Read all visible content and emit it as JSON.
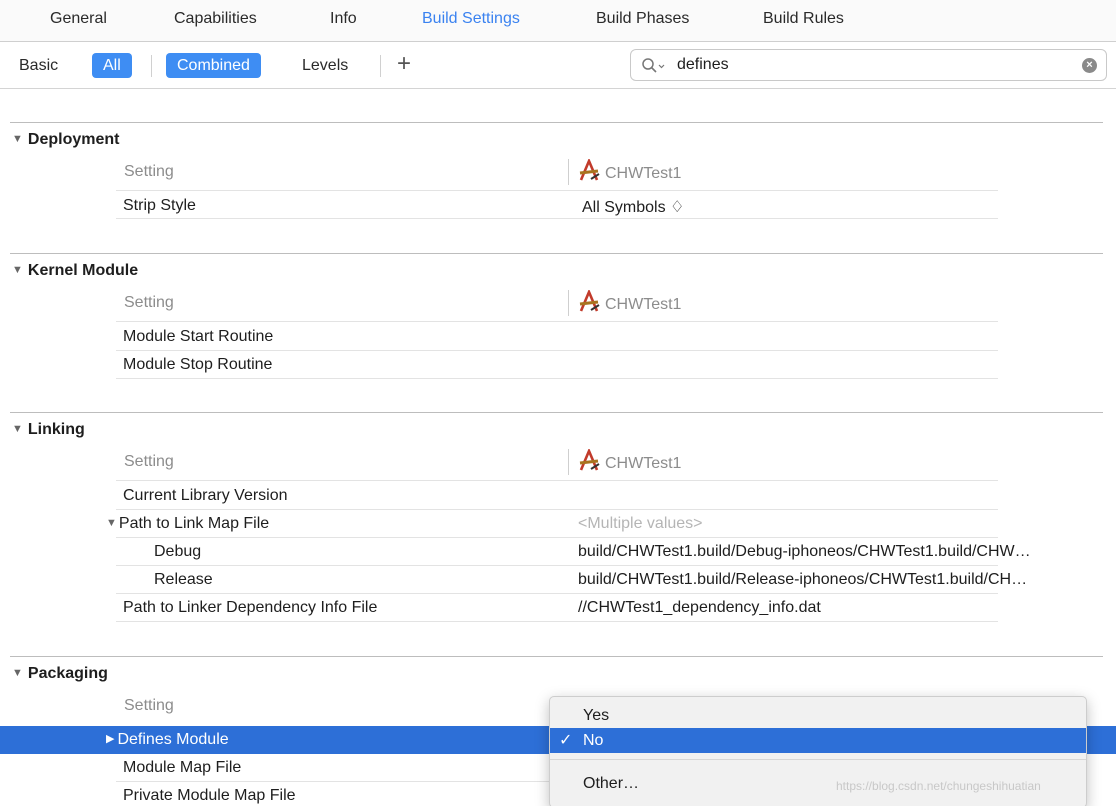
{
  "tabs": [
    "General",
    "Capabilities",
    "Info",
    "Build Settings",
    "Build Phases",
    "Build Rules"
  ],
  "filter": {
    "basic": "Basic",
    "all": "All",
    "combined": "Combined",
    "levels": "Levels",
    "add": "+",
    "search_value": "defines"
  },
  "sections": {
    "deployment": {
      "title": "Deployment",
      "setting_header": "Setting",
      "target": "CHWTest1",
      "strip_style": "Strip Style",
      "strip_style_value": "All Symbols ♢"
    },
    "kernel": {
      "title": "Kernel Module",
      "setting_header": "Setting",
      "target": "CHWTest1",
      "start": "Module Start Routine",
      "stop": "Module Stop Routine"
    },
    "linking": {
      "title": "Linking",
      "setting_header": "Setting",
      "target": "CHWTest1",
      "current_version": "Current Library Version",
      "link_map": "Path to Link Map File",
      "link_map_value": "<Multiple values>",
      "debug": "Debug",
      "debug_value": "build/CHWTest1.build/Debug-iphoneos/CHWTest1.build/CHW…",
      "release": "Release",
      "release_value": "build/CHWTest1.build/Release-iphoneos/CHWTest1.build/CH…",
      "dependency": "Path to Linker Dependency Info File",
      "dependency_value": "//CHWTest1_dependency_info.dat"
    },
    "packaging": {
      "title": "Packaging",
      "setting_header": "Setting",
      "defines_module": "Defines Module",
      "module_map": "Module Map File",
      "private_module_map": "Private Module Map File"
    }
  },
  "popup": {
    "options": [
      "Yes",
      "No",
      "Other…"
    ],
    "selected": "No",
    "checkmark": "✓"
  },
  "watermark": "https://blog.csdn.net/chungeshihuatian"
}
